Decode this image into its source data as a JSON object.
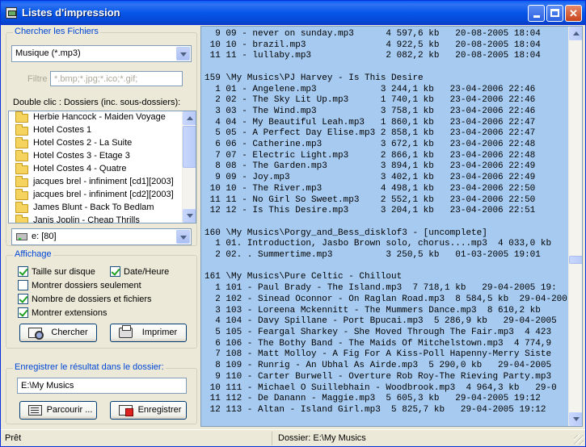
{
  "window": {
    "title": "Listes d'impression"
  },
  "search_group": {
    "label": "Chercher les Fichiers",
    "file_type": "Musique (*.mp3)",
    "filter_label": "Filtre :",
    "filter_value": "*.bmp;*.jpg;*.ico;*.gif;",
    "folders_label": "Double clic : Dossiers (inc. sous-dossiers):",
    "folders": [
      "Herbie Hancock - Maiden Voyage",
      "Hotel Costes 1",
      "Hotel Costes 2 - La Suite",
      "Hotel Costes 3 - Etage 3",
      "Hotel Costes 4 - Quatre",
      "jacques brel - infiniment [cd1][2003]",
      "jacques brel - infiniment [cd2][2003]",
      "James Blunt - Back To Bedlam",
      "Janis Joplin - Cheap Thrills"
    ],
    "drive": "e: [80]"
  },
  "display_group": {
    "label": "Affichage",
    "options": {
      "size": {
        "label": "Taille sur disque",
        "checked": true
      },
      "datetime": {
        "label": "Date/Heure",
        "checked": true
      },
      "folders_only": {
        "label": "Montrer dossiers seulement",
        "checked": false
      },
      "counts": {
        "label": "Nombre de dossiers et fichiers",
        "checked": true
      },
      "extensions": {
        "label": "Montrer extensions",
        "checked": true
      }
    },
    "search_button": "Chercher",
    "print_button": "Imprimer"
  },
  "save_group": {
    "label": "Enregistrer le résultat dans le dossier:",
    "path": "E:\\My Musics",
    "browse_button": "Parcourir ...",
    "save_button": "Enregistrer"
  },
  "output_lines": [
    "  9 09 - never on sunday.mp3      4 597,6 kb   20-08-2005 18:04",
    " 10 10 - brazil.mp3               4 922,5 kb   20-08-2005 18:04",
    " 11 11 - lullaby.mp3              2 082,2 kb   20-08-2005 18:04",
    "",
    "159 \\My Musics\\PJ Harvey - Is This Desire",
    "  1 01 - Angelene.mp3            3 244,1 kb   23-04-2006 22:46",
    "  2 02 - The Sky Lit Up.mp3      1 740,1 kb   23-04-2006 22:46",
    "  3 03 - The Wind.mp3            3 758,1 kb   23-04-2006 22:46",
    "  4 04 - My Beautiful Leah.mp3   1 860,1 kb   23-04-2006 22:47",
    "  5 05 - A Perfect Day Elise.mp3 2 858,1 kb   23-04-2006 22:47",
    "  6 06 - Catherine.mp3           3 672,1 kb   23-04-2006 22:48",
    "  7 07 - Electric Light.mp3      2 866,1 kb   23-04-2006 22:48",
    "  8 08 - The Garden.mp3          3 894,1 kb   23-04-2006 22:49",
    "  9 09 - Joy.mp3                 3 402,1 kb   23-04-2006 22:49",
    " 10 10 - The River.mp3           4 498,1 kb   23-04-2006 22:50",
    " 11 11 - No Girl So Sweet.mp3    2 552,1 kb   23-04-2006 22:50",
    " 12 12 - Is This Desire.mp3      3 204,1 kb   23-04-2006 22:51",
    "",
    "160 \\My Musics\\Porgy_and_Bess_disklof3 - [uncomplete]",
    "  1 01. Introduction, Jasbo Brown solo, chorus....mp3  4 033,0 kb",
    "  2 02. . Summertime.mp3          3 250,5 kb   01-03-2005 19:01",
    "",
    "161 \\My Musics\\Pure Celtic - Chillout",
    "  1 101 - Paul Brady - The Island.mp3  7 718,1 kb   29-04-2005 19:",
    "  2 102 - Sinead Oconnor - On Raglan Road.mp3  8 584,5 kb  29-04-200",
    "  3 103 - Loreena Mckennitt - The Mummers Dance.mp3  8 610,2 kb",
    "  4 104 - Davy Spillane - Port Bpucai.mp3  5 286,9 kb   29-04-2005",
    "  5 105 - Feargal Sharkey - She Moved Through The Fair.mp3  4 423",
    "  6 106 - The Bothy Band - The Maids Of Mitchelstown.mp3  4 774,9",
    "  7 108 - Matt Molloy - A Fig For A Kiss-Poll Hapenny-Merry Siste",
    "  8 109 - Runrig - An Ubhal As Airde.mp3  5 290,0 kb   29-04-2005",
    "  9 110 - Carter Burwell - Overture Rob Roy-The Rieving Party.mp3",
    " 10 111 - Michael O Suillebhain - Woodbrook.mp3  4 964,3 kb   29-0",
    " 11 112 - De Danann - Maggie.mp3  5 605,3 kb   29-04-2005 19:12",
    " 12 113 - Altan - Island Girl.mp3  5 825,7 kb   29-04-2005 19:12"
  ],
  "statusbar": {
    "status": "Prêt",
    "folder": "Dossier:  E:\\My Musics"
  }
}
